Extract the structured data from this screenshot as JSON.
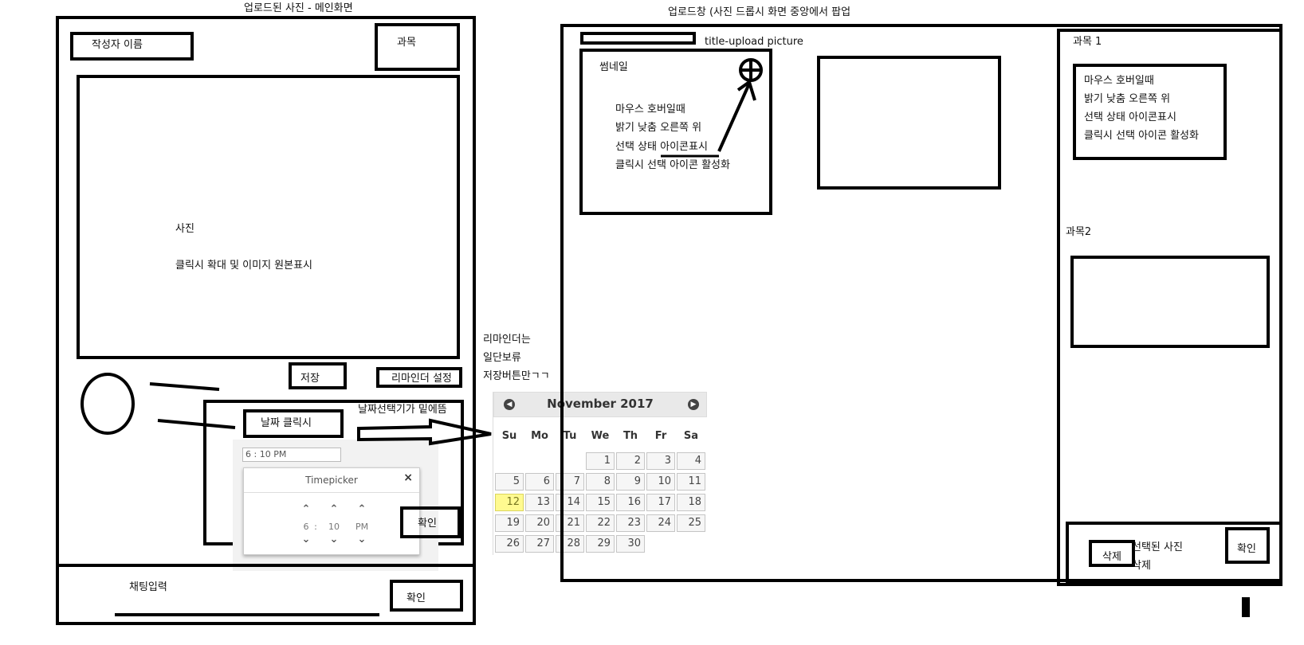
{
  "main_screen": {
    "caption": "업로드된 사진 - 메인화면",
    "author_name": "작성자 이름",
    "subject": "과목",
    "photo_label": "사진",
    "photo_desc": "클릭시 확대 및 이미지 원본표시",
    "save_button": "저장",
    "reminder_button": "리마인더 설정",
    "date_click_button": "날짜 클릭시",
    "date_picker_note": "날짜선택기가 밑에뜸",
    "time_value": "6 : 10 PM",
    "confirm_button": "확인",
    "chat_input_label": "채팅입력",
    "chat_confirm_button": "확인"
  },
  "reminder_note": [
    "리마인더는",
    "일단보류",
    "저장버튼만ㄱㄱ"
  ],
  "timepicker": {
    "title": "Timepicker",
    "close": "×",
    "hour": "6",
    "separator": ":",
    "minute": "10",
    "period": "PM",
    "up": "⌃",
    "down": "⌄"
  },
  "calendar": {
    "month_title": "November 2017",
    "prev": "◀",
    "next": "▶",
    "weekdays": [
      "Su",
      "Mo",
      "Tu",
      "We",
      "Th",
      "Fr",
      "Sa"
    ],
    "weeks": [
      [
        "",
        "",
        "",
        "1",
        "2",
        "3",
        "4"
      ],
      [
        "5",
        "6",
        "7",
        "8",
        "9",
        "10",
        "11"
      ],
      [
        "12",
        "13",
        "14",
        "15",
        "16",
        "17",
        "18"
      ],
      [
        "19",
        "20",
        "21",
        "22",
        "23",
        "24",
        "25"
      ],
      [
        "26",
        "27",
        "28",
        "29",
        "30",
        "",
        ""
      ]
    ],
    "today": "12"
  },
  "upload_window": {
    "caption": "업로드창   (사진 드롭시 화면 중앙에서 팝업",
    "title": "title-upload picture",
    "thumbnail_label": "썸네일",
    "thumbnail_desc": [
      "마우스 호버일때",
      "밝기 낮춤 오른쪽 위",
      "선택 상태 아이콘표시",
      "클릭시 선택 아이콘 활성화"
    ],
    "subject1": "과목 1",
    "subject1_desc": [
      "마우스 호버일때",
      "밝기 낮춤 오른쪽 위",
      "선택 상태 아이콘표시",
      "클릭시 선택 아이콘 활성화"
    ],
    "subject2": "과목2",
    "delete_button": "삭제",
    "selected_delete": [
      "선택된 사진",
      "삭제"
    ],
    "confirm_button": "확인"
  }
}
